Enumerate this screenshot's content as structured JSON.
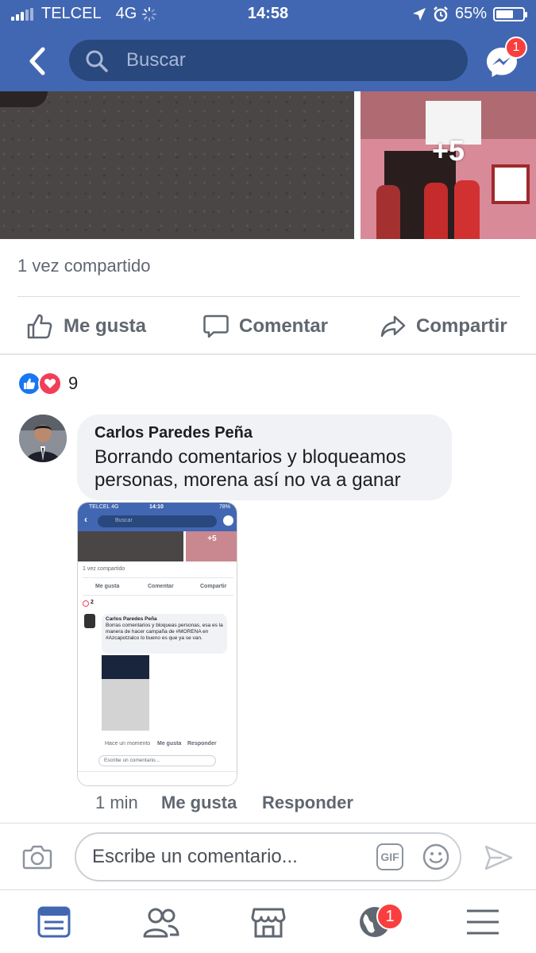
{
  "status_bar": {
    "carrier": "TELCEL",
    "network": "4G",
    "time": "14:58",
    "battery": "65%",
    "battery_level": 0.65
  },
  "nav": {
    "search_placeholder": "Buscar",
    "messenger_badge": "1"
  },
  "post": {
    "more_photos": "+5",
    "shares": "1 vez compartido",
    "actions": {
      "like": "Me gusta",
      "comment": "Comentar",
      "share": "Compartir"
    },
    "reaction_count": "9"
  },
  "comment": {
    "author": "Carlos Paredes Peña",
    "text": "Borrando comentarios y bloqueamos personas, morena así no va a ganar",
    "time": "1 min",
    "like": "Me gusta",
    "reply": "Responder"
  },
  "embedded_screenshot": {
    "carrier": "TELCEL  4G",
    "time": "14:10",
    "battery": "78%",
    "search": "Buscar",
    "more": "+5",
    "shares": "1 vez compartido",
    "like": "Me gusta",
    "comment": "Comentar",
    "share": "Compartir",
    "reactions": "2",
    "author": "Carlos Paredes Peña",
    "text": "Borras comentarios y bloqueas personas, esa es la manera de hacer campaña de #MORENA en #Azcapotzalco lo bueno es que ya se van.",
    "meta_time": "Hace un momento",
    "meta_like": "Me gusta",
    "meta_reply": "Responder",
    "input": "Escribe un comentario..."
  },
  "composer": {
    "placeholder": "Escribe un comentario...",
    "gif": "GIF"
  },
  "tabbar": {
    "notifications_badge": "1"
  },
  "colors": {
    "brand": "#4267b2",
    "search_bg": "#29487d",
    "badge": "#fa3e3e",
    "like": "#1877f2",
    "love": "#f33e58",
    "muted_text": "#606770"
  }
}
